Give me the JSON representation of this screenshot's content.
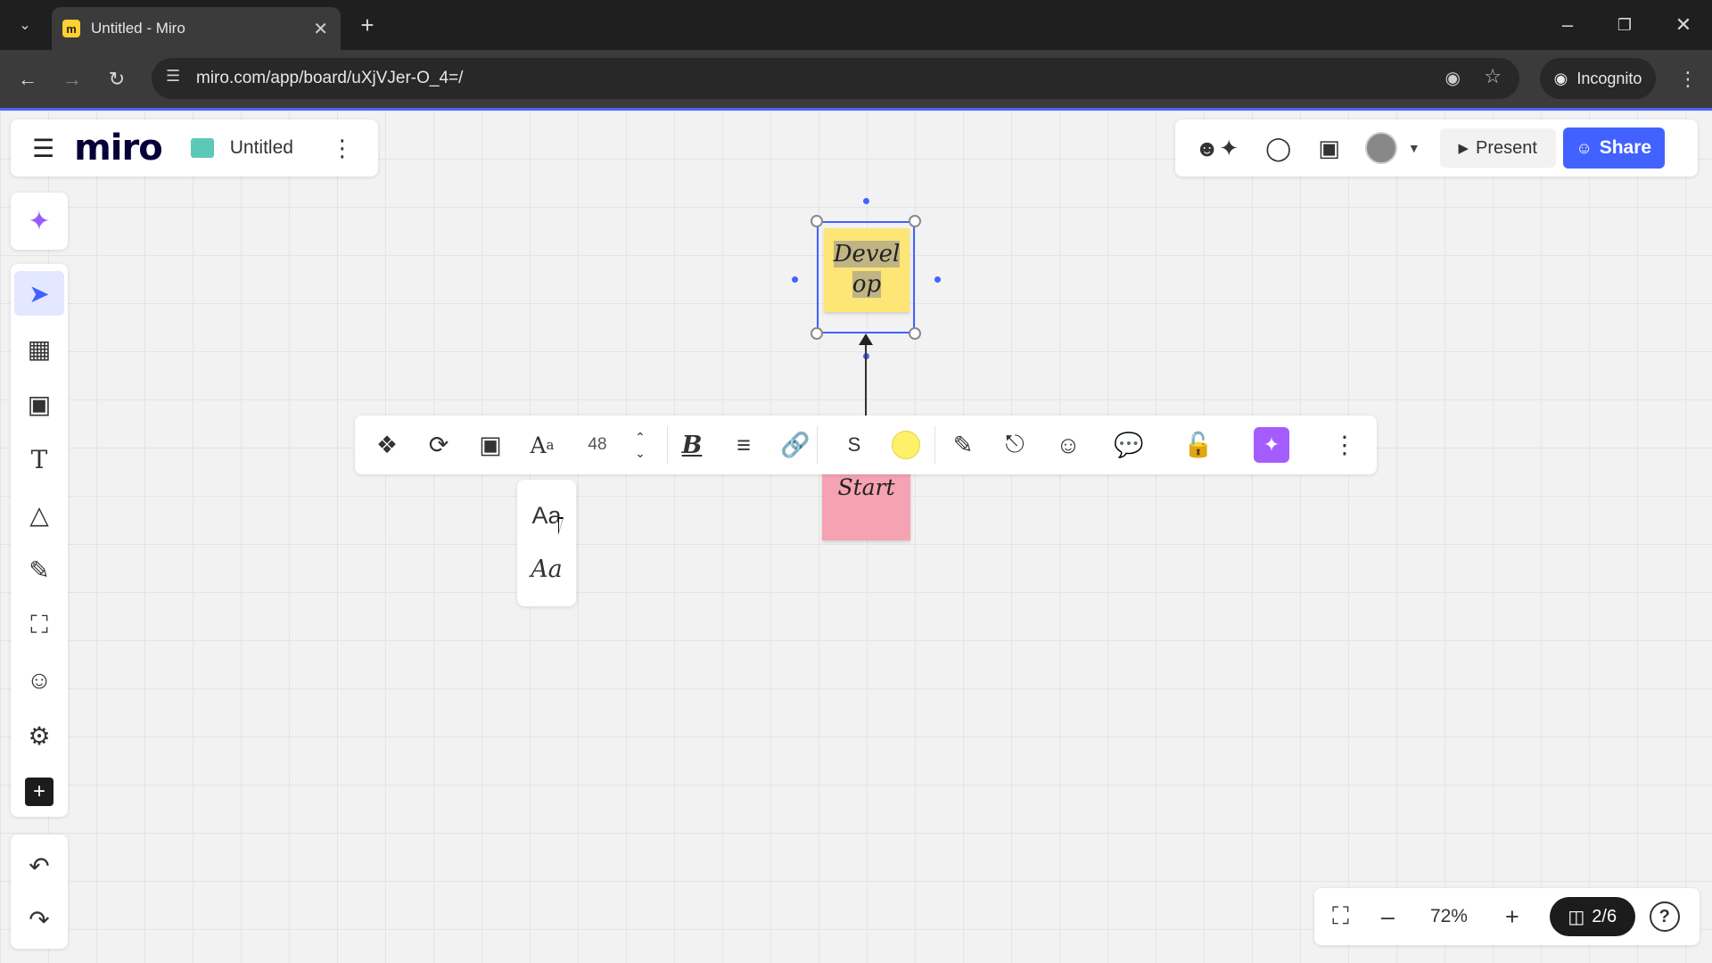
{
  "browser": {
    "tab_title": "Untitled - Miro",
    "favicon_letter": "m",
    "url": "miro.com/app/board/uXjVJer-O_4=/",
    "incognito_label": "Incognito"
  },
  "board": {
    "logo": "miro",
    "title": "Untitled"
  },
  "header": {
    "present_label": "Present",
    "share_label": "Share"
  },
  "notes": {
    "develop_line1": "Devel",
    "develop_line2": "op",
    "develop_color": "#fde676",
    "start": "Start",
    "start_color": "#f5a3b3"
  },
  "context_toolbar": {
    "font_size": "48",
    "stroke_label": "S",
    "color": "#fff069"
  },
  "font_menu": {
    "option1": "Aa",
    "option2": "Aa"
  },
  "zoom": {
    "level": "72%",
    "board_count": "2/6"
  },
  "colors": {
    "accent": "#4262ff",
    "ai_purple": "#a45cff"
  }
}
